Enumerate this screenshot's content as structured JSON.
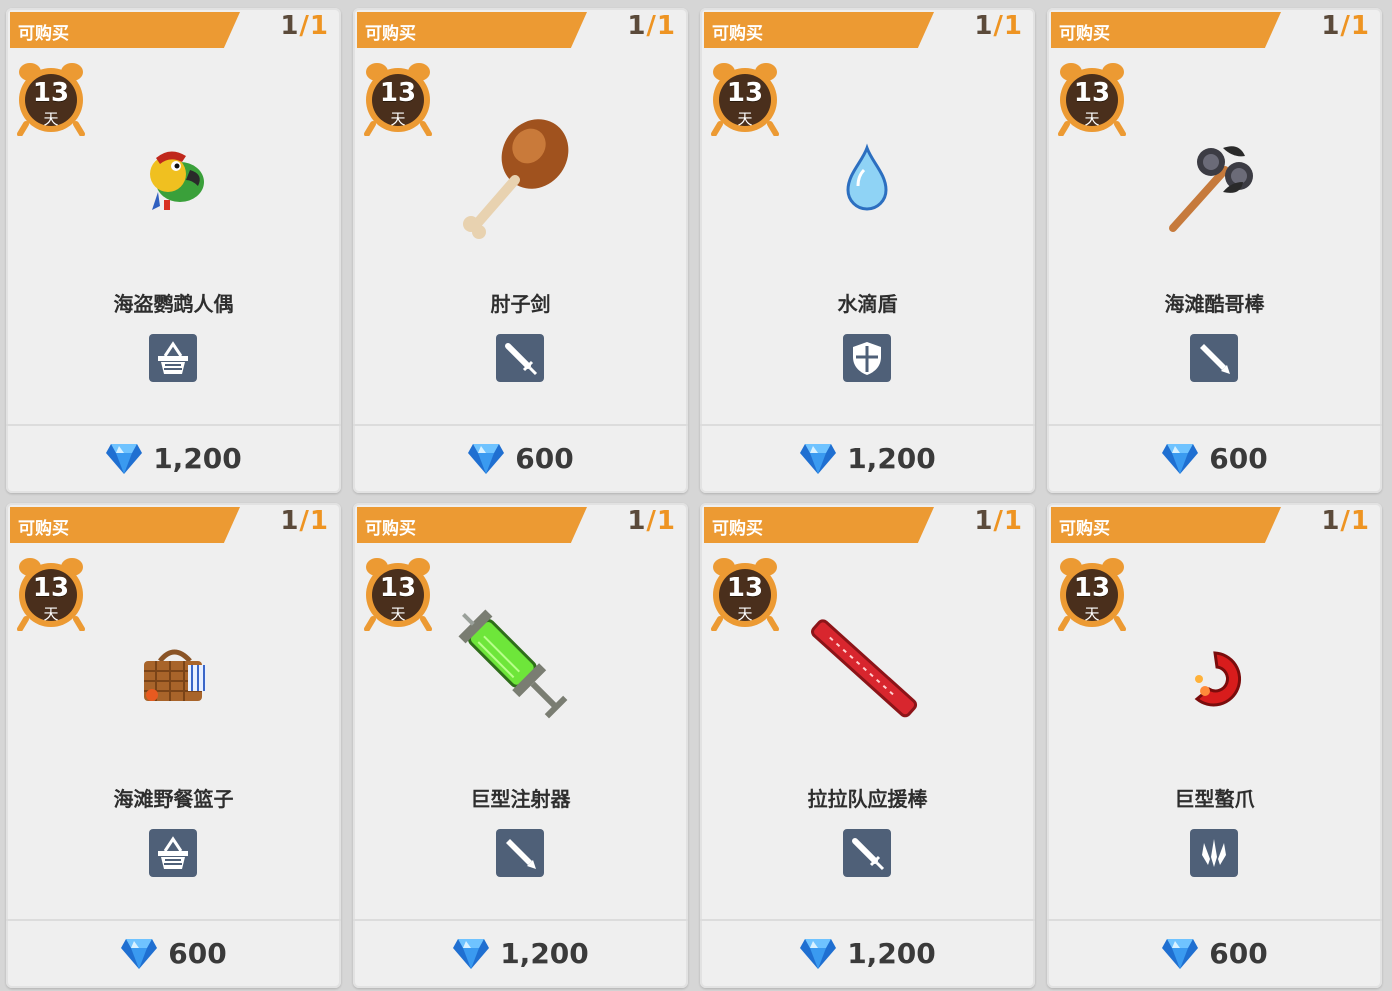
{
  "buy_label": "可购买",
  "day_unit": "天",
  "colors": {
    "tag_orange": "#ec9a33",
    "limit_orange": "#ee9422",
    "icon_slate": "#4f6078",
    "gem_blue": "#2f8fe6"
  },
  "items": [
    {
      "limit_current": "1",
      "limit_max": "1",
      "days": "13",
      "name": "海盗鹦鹉人偶",
      "type": "basket-icon",
      "art": "parrot",
      "price": "1,200"
    },
    {
      "limit_current": "1",
      "limit_max": "1",
      "days": "13",
      "name": "肘子剑",
      "type": "sword-icon",
      "art": "drumstick",
      "price": "600"
    },
    {
      "limit_current": "1",
      "limit_max": "1",
      "days": "13",
      "name": "水滴盾",
      "type": "shield-icon",
      "art": "waterdrop",
      "price": "1,200"
    },
    {
      "limit_current": "1",
      "limit_max": "1",
      "days": "13",
      "name": "海滩酷哥棒",
      "type": "blade-icon",
      "art": "sunglasses-club",
      "price": "600"
    },
    {
      "limit_current": "1",
      "limit_max": "1",
      "days": "13",
      "name": "海滩野餐篮子",
      "type": "basket-icon",
      "art": "picnic-basket",
      "price": "600"
    },
    {
      "limit_current": "1",
      "limit_max": "1",
      "days": "13",
      "name": "巨型注射器",
      "type": "blade-icon",
      "art": "syringe",
      "price": "1,200"
    },
    {
      "limit_current": "1",
      "limit_max": "1",
      "days": "13",
      "name": "拉拉队应援棒",
      "type": "sword-icon",
      "art": "cheer-stick",
      "price": "1,200"
    },
    {
      "limit_current": "1",
      "limit_max": "1",
      "days": "13",
      "name": "巨型螯爪",
      "type": "claw-icon",
      "art": "claw",
      "price": "600"
    }
  ]
}
